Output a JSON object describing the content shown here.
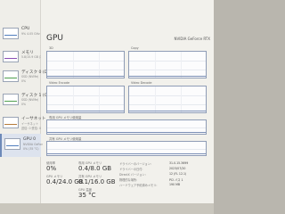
{
  "sidebar": {
    "items": [
      {
        "title": "CPU",
        "sub": "9% 4.05 GHz",
        "sub2": "",
        "accent": "#4f7dbd",
        "selected": false
      },
      {
        "title": "メモリ",
        "sub": "5.8/15.9 GB (36%)",
        "sub2": "",
        "accent": "#8a4fb5",
        "selected": false
      },
      {
        "title": "ディスク 0 (D:)",
        "sub": "SSD (NVMe)",
        "sub2": "0%",
        "accent": "#4f9f4f",
        "selected": false
      },
      {
        "title": "ディスク 1 (C:)",
        "sub": "SSD (NVMe)",
        "sub2": "0%",
        "accent": "#4f9f4f",
        "selected": false
      },
      {
        "title": "イーサネット",
        "sub": "イーサネット",
        "sub2": "送信: 0 受信: 0 Kbps",
        "accent": "#b57a3a",
        "selected": false
      },
      {
        "title": "GPU 0",
        "sub": "NVIDIA GeForce R...",
        "sub2": "0% (35 °C)",
        "accent": "#4f7dbd",
        "selected": true
      }
    ]
  },
  "header": {
    "title": "GPU",
    "device": "NVIDIA GeForce RTX"
  },
  "panels": {
    "p1": "3D",
    "p2": "Copy",
    "p3": "Video Encode",
    "p4": "Video Decode",
    "p5": "専用 GPU メモリ使用量",
    "p6": "共有 GPU メモリ使用量"
  },
  "stats": {
    "util_label": "使用率",
    "util_value": "0%",
    "ded_label": "専用 GPU メモリ",
    "ded_value": "0.4/8.0 GB",
    "drv_label": "ドライバーのバージョン:",
    "drv_value": "31.0.15.3699",
    "gpu_mem_label": "GPU メモリ",
    "gpu_mem_value": "0.4/24.0 GB",
    "shared_label": "共有 GPU メモリ",
    "shared_value": "0.1/16.0 GB",
    "date_label": "ドライバーの日付:",
    "date_value": "2023/07/20",
    "dx_label": "DirectX バージョン:",
    "dx_value": "12 (FL 12.1)",
    "loc_label": "物理的な場所:",
    "loc_value": "PCI バス 1",
    "hw_label": "ハードウェア予約済みメモリ:",
    "hw_value": "190 MB",
    "temp_label": "GPU 温度",
    "temp_value": "35 °C"
  }
}
